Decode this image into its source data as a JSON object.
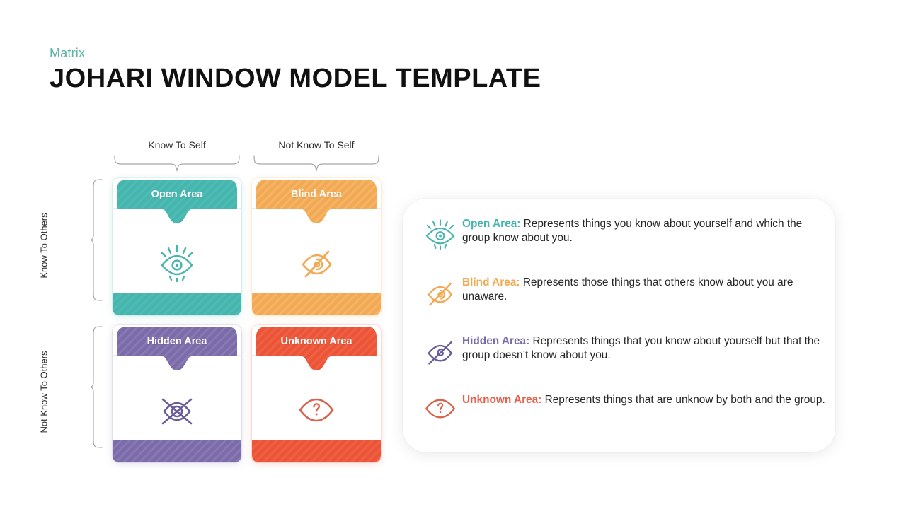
{
  "header": {
    "eyebrow": "Matrix",
    "title": "JOHARI WINDOW MODEL TEMPLATE"
  },
  "axes": {
    "columns": [
      {
        "label": "Know To Self"
      },
      {
        "label": "Not Know To Self"
      }
    ],
    "rows": [
      {
        "label": "Know To Others"
      },
      {
        "label": "Not Know To Others"
      }
    ]
  },
  "quadrants": [
    {
      "title": "Open Area",
      "icon": "eye-rays-icon",
      "color": "#45B5AE"
    },
    {
      "title": "Blind Area",
      "icon": "eye-slash-icon",
      "color": "#F2A951"
    },
    {
      "title": "Hidden Area",
      "icon": "eye-cross-x-icon",
      "color": "#7B6BA8"
    },
    {
      "title": "Unknown Area",
      "icon": "eye-question-icon",
      "color": "#EC5436"
    }
  ],
  "legend": [
    {
      "term": "Open Area:",
      "description": "Represents things you know about yourself and which the group know about you.",
      "icon": "eye-rays-icon",
      "color": "#45B5AE"
    },
    {
      "term": "Blind Area:",
      "description": "Represents those things that others know about you are unaware.",
      "icon": "eye-slash-icon",
      "color": "#F2A951"
    },
    {
      "term": "Hidden Area:",
      "description": "Represents things that you know about yourself but that the group doesn’t  know about you.",
      "icon": "eye-spiral-slash-icon",
      "color": "#7B6BA8"
    },
    {
      "term": "Unknown Area:",
      "description": "Represents things that are unknow by both and the group.",
      "icon": "eye-question-icon",
      "color": "#EC5436"
    }
  ]
}
